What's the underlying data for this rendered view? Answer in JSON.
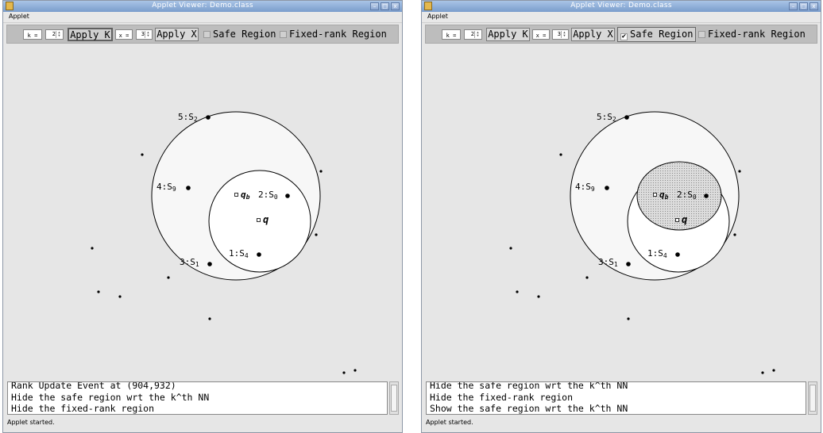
{
  "window_title": "Applet Viewer: Demo.class",
  "menu": "Applet",
  "title_buttons": [
    "–",
    "□",
    "x"
  ],
  "colors": {
    "titlebar": "#8aaadb",
    "toolbar": "#bdbdbd",
    "canvas": "#e6e6e6",
    "disk": "#f7f7f7",
    "safe_region": "#d6d6d6"
  },
  "panels": [
    {
      "toolbar": {
        "k_label": "k =",
        "k_value": "2",
        "apply_k": "Apply K",
        "x_label": "x =",
        "x_value": "3",
        "apply_x": "Apply X",
        "safe_region": "Safe Region",
        "safe_region_checked": false,
        "fixed_rank": "Fixed-rank Region",
        "fixed_rank_checked": false
      },
      "labels": {
        "s2": "5:S",
        "s2_sub": "2",
        "s9": "4:S",
        "s9_sub": "9",
        "qb": "q",
        "qb_sub": "b",
        "s0": "2:S",
        "s0_sub": "0",
        "q": "q",
        "s4": "1:S",
        "s4_sub": "4",
        "s1": "3:S",
        "s1_sub": "1"
      },
      "log": [
        "Rank Update Event at (904,932)",
        "Hide the safe region wrt the k^th NN",
        "Hide the fixed-rank region"
      ],
      "status": "Applet started."
    },
    {
      "toolbar": {
        "k_label": "k =",
        "k_value": "2",
        "apply_k": "Apply K",
        "x_label": "x =",
        "x_value": "3",
        "apply_x": "Apply X",
        "safe_region": "Safe Region",
        "safe_region_checked": true,
        "fixed_rank": "Fixed-rank Region",
        "fixed_rank_checked": false
      },
      "labels": {
        "s2": "5:S",
        "s2_sub": "2",
        "s9": "4:S",
        "s9_sub": "9",
        "qb": "q",
        "qb_sub": "b",
        "s0": "2:S",
        "s0_sub": "0",
        "q": "q",
        "s4": "1:S",
        "s4_sub": "4",
        "s1": "3:S",
        "s1_sub": "1"
      },
      "log": [
        "Hide the safe region wrt the k^th NN",
        "Hide the fixed-rank region",
        "Show the safe region wrt the k^th NN"
      ],
      "status": "Applet started."
    }
  ]
}
